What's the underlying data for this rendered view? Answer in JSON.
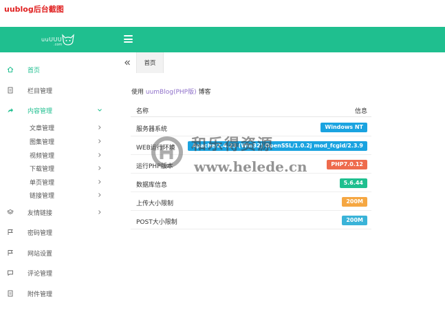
{
  "caption": "uublog后台截图",
  "header": {
    "logo_text": "uuUUU",
    "logo_sub": ".com"
  },
  "sidebar": {
    "items": [
      {
        "label": "首页",
        "icon": "home-icon",
        "active": false
      },
      {
        "label": "栏目管理",
        "icon": "doc-icon"
      },
      {
        "label": "内容管理",
        "icon": "share-icon",
        "active": true
      },
      {
        "label": "友情链接",
        "icon": "layers-icon"
      },
      {
        "label": "密码管理",
        "icon": "flag-icon"
      },
      {
        "label": "网站设置",
        "icon": "flag-icon"
      },
      {
        "label": "评论管理",
        "icon": "comment-icon"
      },
      {
        "label": "附件管理",
        "icon": "doc-icon"
      }
    ],
    "sub_items": [
      "文章管理",
      "图集管理",
      "视频管理",
      "下载管理",
      "单页管理",
      "链接管理"
    ]
  },
  "tabs": {
    "home": "首页"
  },
  "welcome": {
    "prefix": "使用 ",
    "brand": "uumBlog(PHP版)",
    "suffix": " 博客"
  },
  "table": {
    "headers": {
      "name": "名称",
      "info": "信息"
    },
    "rows": [
      {
        "name": "服务器系统",
        "value": "Windows NT",
        "color": "#1aa3e0"
      },
      {
        "name": "WEB运行环境",
        "value": "Apache/2.4.23 (Win32) OpenSSL/1.0.2j mod_fcgid/2.3.9",
        "color": "#1aa3e0"
      },
      {
        "name": "运行PHP版本",
        "value": "PHP7.0.12",
        "color": "#ee6b4d"
      },
      {
        "name": "数据库信息",
        "value": "5.6.44",
        "color": "#1fbf8f"
      },
      {
        "name": "上传大小限制",
        "value": "200M",
        "color": "#f5a742"
      },
      {
        "name": "POST大小限制",
        "value": "200M",
        "color": "#3ab3d8"
      }
    ]
  },
  "watermark": {
    "line1": "和乐得资源",
    "line2": "www.helede.cn"
  },
  "colors": {
    "brand": "#1fbf8f",
    "caption": "#e02020"
  }
}
